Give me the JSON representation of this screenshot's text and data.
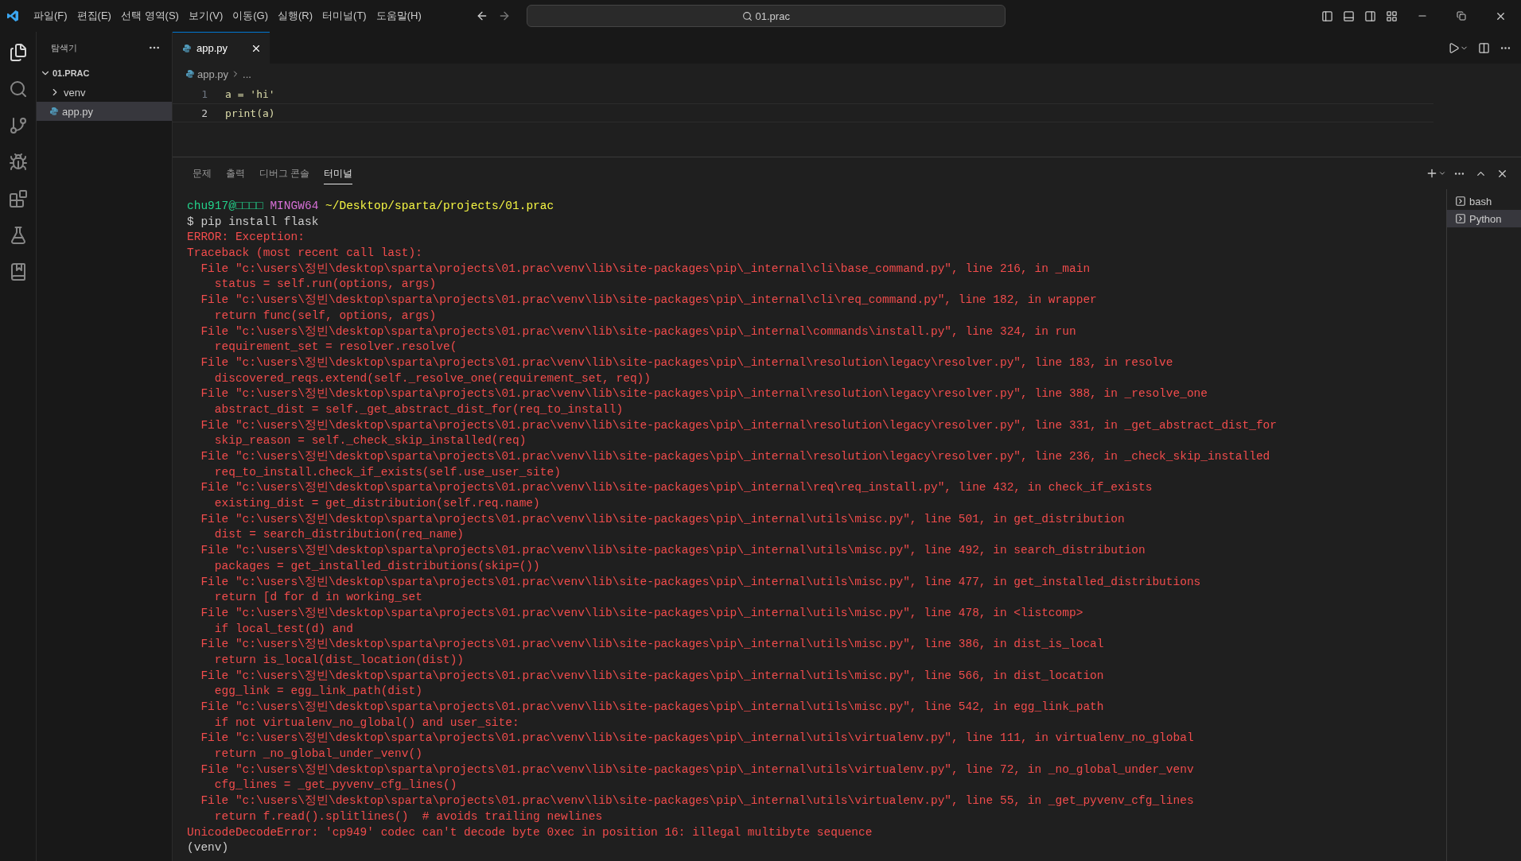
{
  "menu": [
    "파일(F)",
    "편집(E)",
    "선택 영역(S)",
    "보기(V)",
    "이동(G)",
    "실행(R)",
    "터미널(T)",
    "도움말(H)"
  ],
  "command_center": {
    "text": "01.prac"
  },
  "sidebar": {
    "title": "탐색기",
    "folder": "01.PRAC",
    "items": [
      {
        "label": "venv",
        "kind": "folder",
        "expanded": false,
        "selected": false
      },
      {
        "label": "app.py",
        "kind": "file",
        "selected": true
      }
    ]
  },
  "editor": {
    "tabs": [
      {
        "label": "app.py",
        "selected": true
      }
    ],
    "breadcrumb": [
      "app.py",
      "..."
    ],
    "lines": [
      {
        "number": "1",
        "code": "a = 'hi'",
        "current": false
      },
      {
        "number": "2",
        "code": "print(a)",
        "current": true
      }
    ]
  },
  "panel": {
    "tabs": [
      {
        "label": "문제",
        "selected": false
      },
      {
        "label": "출력",
        "selected": false
      },
      {
        "label": "디버그 콘솔",
        "selected": false
      },
      {
        "label": "터미널",
        "selected": true
      }
    ],
    "terminals": [
      {
        "label": "bash",
        "selected": false
      },
      {
        "label": "Python",
        "selected": true
      }
    ],
    "lines": [
      {
        "kind": "prompt",
        "user": "chu917@□□□□",
        "host": "MINGW64",
        "path": "~/Desktop/sparta/projects/01.prac"
      },
      {
        "kind": "plain",
        "text": "$ pip install flask"
      },
      {
        "kind": "error",
        "text": "ERROR: Exception:"
      },
      {
        "kind": "error",
        "text": "Traceback (most recent call last):"
      },
      {
        "kind": "error",
        "text": "  File \"c:\\users\\정빈\\desktop\\sparta\\projects\\01.prac\\venv\\lib\\site-packages\\pip\\_internal\\cli\\base_command.py\", line 216, in _main"
      },
      {
        "kind": "error",
        "text": "    status = self.run(options, args)"
      },
      {
        "kind": "error",
        "text": "  File \"c:\\users\\정빈\\desktop\\sparta\\projects\\01.prac\\venv\\lib\\site-packages\\pip\\_internal\\cli\\req_command.py\", line 182, in wrapper"
      },
      {
        "kind": "error",
        "text": "    return func(self, options, args)"
      },
      {
        "kind": "error",
        "text": "  File \"c:\\users\\정빈\\desktop\\sparta\\projects\\01.prac\\venv\\lib\\site-packages\\pip\\_internal\\commands\\install.py\", line 324, in run"
      },
      {
        "kind": "error",
        "text": "    requirement_set = resolver.resolve("
      },
      {
        "kind": "error",
        "text": "  File \"c:\\users\\정빈\\desktop\\sparta\\projects\\01.prac\\venv\\lib\\site-packages\\pip\\_internal\\resolution\\legacy\\resolver.py\", line 183, in resolve"
      },
      {
        "kind": "error",
        "text": "    discovered_reqs.extend(self._resolve_one(requirement_set, req))"
      },
      {
        "kind": "error",
        "text": "  File \"c:\\users\\정빈\\desktop\\sparta\\projects\\01.prac\\venv\\lib\\site-packages\\pip\\_internal\\resolution\\legacy\\resolver.py\", line 388, in _resolve_one"
      },
      {
        "kind": "error",
        "text": "    abstract_dist = self._get_abstract_dist_for(req_to_install)"
      },
      {
        "kind": "error",
        "text": "  File \"c:\\users\\정빈\\desktop\\sparta\\projects\\01.prac\\venv\\lib\\site-packages\\pip\\_internal\\resolution\\legacy\\resolver.py\", line 331, in _get_abstract_dist_for"
      },
      {
        "kind": "error",
        "text": "    skip_reason = self._check_skip_installed(req)"
      },
      {
        "kind": "error",
        "text": "  File \"c:\\users\\정빈\\desktop\\sparta\\projects\\01.prac\\venv\\lib\\site-packages\\pip\\_internal\\resolution\\legacy\\resolver.py\", line 236, in _check_skip_installed"
      },
      {
        "kind": "error",
        "text": "    req_to_install.check_if_exists(self.use_user_site)"
      },
      {
        "kind": "error",
        "text": "  File \"c:\\users\\정빈\\desktop\\sparta\\projects\\01.prac\\venv\\lib\\site-packages\\pip\\_internal\\req\\req_install.py\", line 432, in check_if_exists"
      },
      {
        "kind": "error",
        "text": "    existing_dist = get_distribution(self.req.name)"
      },
      {
        "kind": "error",
        "text": "  File \"c:\\users\\정빈\\desktop\\sparta\\projects\\01.prac\\venv\\lib\\site-packages\\pip\\_internal\\utils\\misc.py\", line 501, in get_distribution"
      },
      {
        "kind": "error",
        "text": "    dist = search_distribution(req_name)"
      },
      {
        "kind": "error",
        "text": "  File \"c:\\users\\정빈\\desktop\\sparta\\projects\\01.prac\\venv\\lib\\site-packages\\pip\\_internal\\utils\\misc.py\", line 492, in search_distribution"
      },
      {
        "kind": "error",
        "text": "    packages = get_installed_distributions(skip=())"
      },
      {
        "kind": "error",
        "text": "  File \"c:\\users\\정빈\\desktop\\sparta\\projects\\01.prac\\venv\\lib\\site-packages\\pip\\_internal\\utils\\misc.py\", line 477, in get_installed_distributions"
      },
      {
        "kind": "error",
        "text": "    return [d for d in working_set"
      },
      {
        "kind": "error",
        "text": "  File \"c:\\users\\정빈\\desktop\\sparta\\projects\\01.prac\\venv\\lib\\site-packages\\pip\\_internal\\utils\\misc.py\", line 478, in <listcomp>"
      },
      {
        "kind": "error",
        "text": "    if local_test(d) and"
      },
      {
        "kind": "error",
        "text": "  File \"c:\\users\\정빈\\desktop\\sparta\\projects\\01.prac\\venv\\lib\\site-packages\\pip\\_internal\\utils\\misc.py\", line 386, in dist_is_local"
      },
      {
        "kind": "error",
        "text": "    return is_local(dist_location(dist))"
      },
      {
        "kind": "error",
        "text": "  File \"c:\\users\\정빈\\desktop\\sparta\\projects\\01.prac\\venv\\lib\\site-packages\\pip\\_internal\\utils\\misc.py\", line 566, in dist_location"
      },
      {
        "kind": "error",
        "text": "    egg_link = egg_link_path(dist)"
      },
      {
        "kind": "error",
        "text": "  File \"c:\\users\\정빈\\desktop\\sparta\\projects\\01.prac\\venv\\lib\\site-packages\\pip\\_internal\\utils\\misc.py\", line 542, in egg_link_path"
      },
      {
        "kind": "error",
        "text": "    if not virtualenv_no_global() and user_site:"
      },
      {
        "kind": "error",
        "text": "  File \"c:\\users\\정빈\\desktop\\sparta\\projects\\01.prac\\venv\\lib\\site-packages\\pip\\_internal\\utils\\virtualenv.py\", line 111, in virtualenv_no_global"
      },
      {
        "kind": "error",
        "text": "    return _no_global_under_venv()"
      },
      {
        "kind": "error",
        "text": "  File \"c:\\users\\정빈\\desktop\\sparta\\projects\\01.prac\\venv\\lib\\site-packages\\pip\\_internal\\utils\\virtualenv.py\", line 72, in _no_global_under_venv"
      },
      {
        "kind": "error",
        "text": "    cfg_lines = _get_pyvenv_cfg_lines()"
      },
      {
        "kind": "error",
        "text": "  File \"c:\\users\\정빈\\desktop\\sparta\\projects\\01.prac\\venv\\lib\\site-packages\\pip\\_internal\\utils\\virtualenv.py\", line 55, in _get_pyvenv_cfg_lines"
      },
      {
        "kind": "error",
        "text": "    return f.read().splitlines()  # avoids trailing newlines"
      },
      {
        "kind": "error",
        "text": "UnicodeDecodeError: 'cp949' codec can't decode byte 0xec in position 16: illegal multibyte sequence"
      },
      {
        "kind": "plain",
        "text": "(venv)"
      }
    ]
  }
}
